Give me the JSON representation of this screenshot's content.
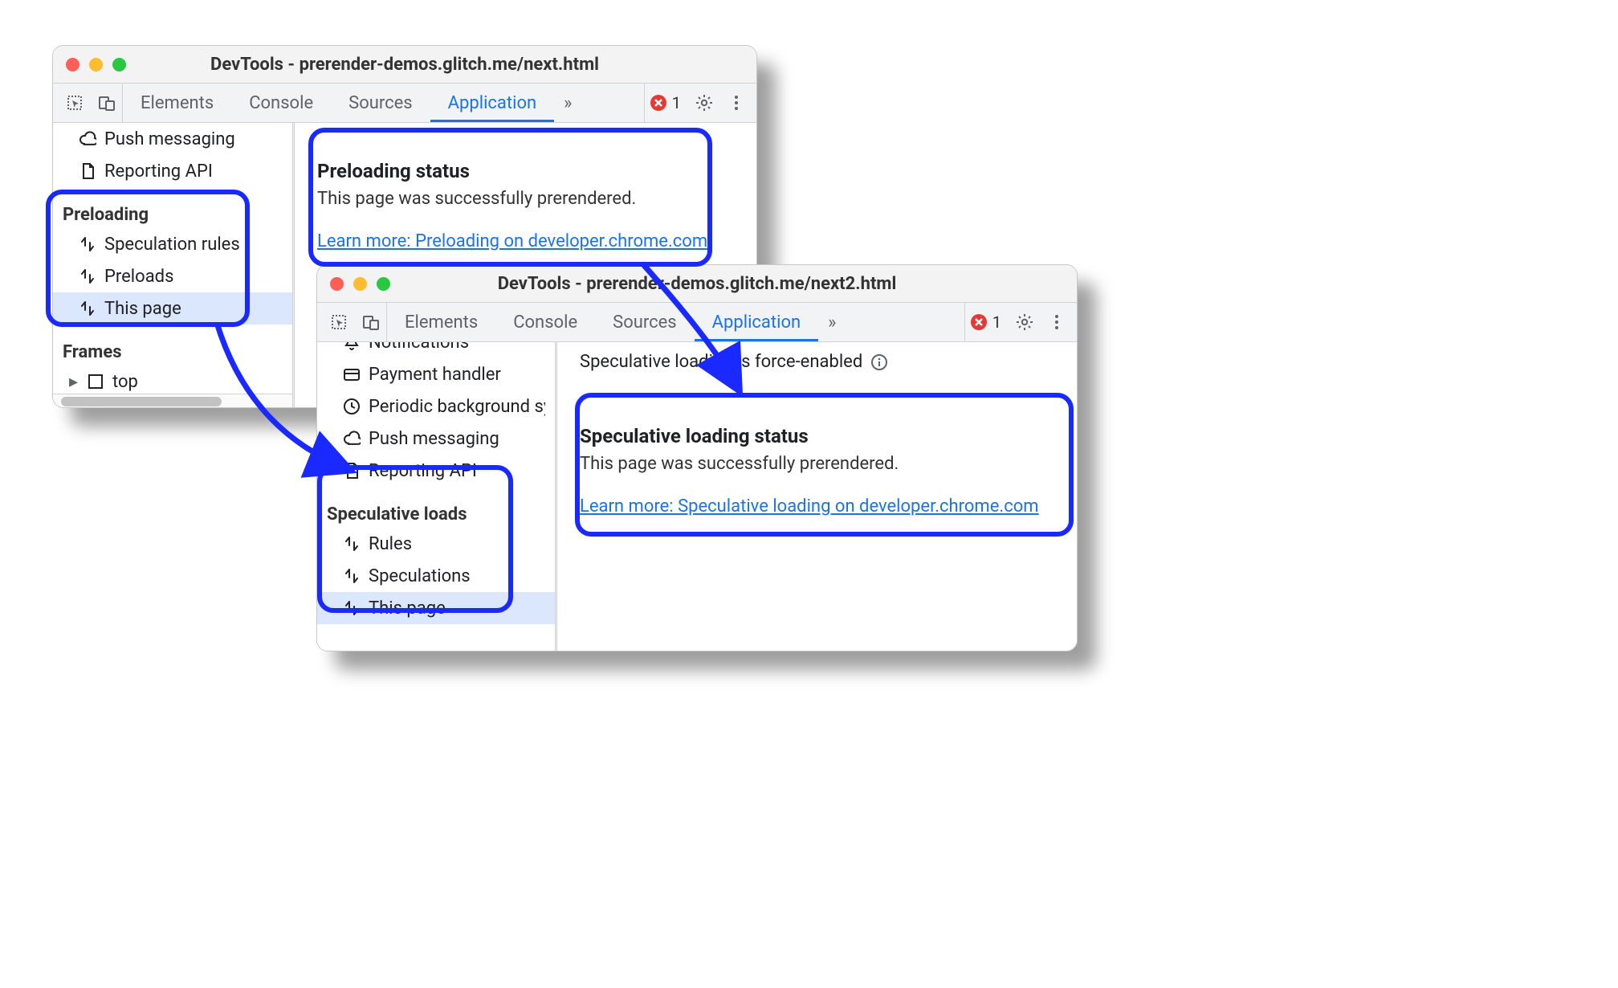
{
  "window1": {
    "title": "DevTools - prerender-demos.glitch.me/next.html",
    "tabs": [
      "Elements",
      "Console",
      "Sources",
      "Application"
    ],
    "active_tab": "Application",
    "more_glyph": "»",
    "error_count": "1",
    "sidebar": {
      "top_items": [
        {
          "icon": "cloud",
          "label": "Push messaging"
        },
        {
          "icon": "doc",
          "label": "Reporting API"
        }
      ],
      "preloading_title": "Preloading",
      "preloading_items": [
        {
          "label": "Speculation rules",
          "selected": false
        },
        {
          "label": "Preloads",
          "selected": false
        },
        {
          "label": "This page",
          "selected": true
        }
      ],
      "frames_title": "Frames",
      "frames_item": {
        "label": "top"
      }
    },
    "panel": {
      "heading": "Preloading status",
      "body": "This page was successfully prerendered.",
      "link": "Learn more: Preloading on developer.chrome.com"
    }
  },
  "window2": {
    "title": "DevTools - prerender-demos.glitch.me/next2.html",
    "tabs": [
      "Elements",
      "Console",
      "Sources",
      "Application"
    ],
    "active_tab": "Application",
    "more_glyph": "»",
    "error_count": "1",
    "sidebar": {
      "top_items": [
        {
          "icon": "bell",
          "label": "Notifications"
        },
        {
          "icon": "card",
          "label": "Payment handler"
        },
        {
          "icon": "clock",
          "label": "Periodic background sy"
        },
        {
          "icon": "cloud",
          "label": "Push messaging"
        },
        {
          "icon": "doc",
          "label": "Reporting API"
        }
      ],
      "section_title": "Speculative loads",
      "items": [
        {
          "label": "Rules",
          "selected": false
        },
        {
          "label": "Speculations",
          "selected": false
        },
        {
          "label": "This page",
          "selected": true
        }
      ]
    },
    "panel": {
      "top_note": "Speculative loading is force-enabled",
      "heading": "Speculative loading status",
      "body": "This page was successfully prerendered.",
      "link": "Learn more: Speculative loading on developer.chrome.com"
    }
  }
}
